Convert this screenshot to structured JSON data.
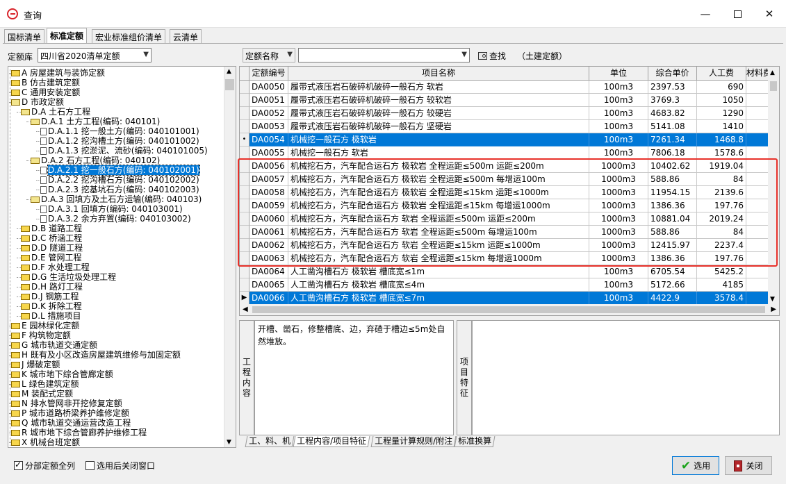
{
  "window": {
    "title": "查询"
  },
  "tabs": [
    {
      "label": "国标清单",
      "active": false
    },
    {
      "label": "标准定额",
      "active": true
    },
    {
      "label": "宏业标准组价清单",
      "active": false
    },
    {
      "label": "云清单",
      "active": false
    }
  ],
  "toolbar": {
    "lib_label": "定额库",
    "lib_value": "四川省2020清单定额",
    "field_value": "定额名称",
    "search_value": "",
    "find_label": "查找",
    "category_note": "（土建定额）"
  },
  "tree": [
    {
      "label": "A 房屋建筑与装饰定额",
      "level": 0,
      "icon": "folder"
    },
    {
      "label": "B 仿古建筑定额",
      "level": 0,
      "icon": "folder"
    },
    {
      "label": "C 通用安装定额",
      "level": 0,
      "icon": "folder"
    },
    {
      "label": "D 市政定额",
      "level": 0,
      "icon": "folder-open"
    },
    {
      "label": "D.A 土石方工程",
      "level": 1,
      "icon": "folder-open"
    },
    {
      "label": "D.A.1 土方工程(编码: 040101)",
      "level": 2,
      "icon": "folder-open"
    },
    {
      "label": "D.A.1.1 挖一般土方(编码: 040101001)",
      "level": 3,
      "icon": "doc"
    },
    {
      "label": "D.A.1.2 挖沟槽土方(编码: 040101002)",
      "level": 3,
      "icon": "doc"
    },
    {
      "label": "D.A.1.3 挖淤泥、流砂(编码: 040101005)",
      "level": 3,
      "icon": "doc"
    },
    {
      "label": "D.A.2 石方工程(编码: 040102)",
      "level": 2,
      "icon": "folder-open"
    },
    {
      "label": "D.A.2.1 挖一般石方(编码: 040102001)",
      "level": 3,
      "icon": "doc",
      "selected": true
    },
    {
      "label": "D.A.2.2 挖沟槽石方(编码: 040102002)",
      "level": 3,
      "icon": "doc"
    },
    {
      "label": "D.A.2.3 挖基坑石方(编码: 040102003)",
      "level": 3,
      "icon": "doc"
    },
    {
      "label": "D.A.3 回填方及土石方运输(编码: 040103)",
      "level": 2,
      "icon": "folder-open"
    },
    {
      "label": "D.A.3.1 回填方(编码: 040103001)",
      "level": 3,
      "icon": "doc"
    },
    {
      "label": "D.A.3.2 余方弃置(编码: 040103002)",
      "level": 3,
      "icon": "doc"
    },
    {
      "label": "D.B 道路工程",
      "level": 1,
      "icon": "folder"
    },
    {
      "label": "D.C 桥涵工程",
      "level": 1,
      "icon": "folder"
    },
    {
      "label": "D.D 隧道工程",
      "level": 1,
      "icon": "folder"
    },
    {
      "label": "D.E 管网工程",
      "level": 1,
      "icon": "folder"
    },
    {
      "label": "D.F 水处理工程",
      "level": 1,
      "icon": "folder"
    },
    {
      "label": "D.G 生活垃圾处理工程",
      "level": 1,
      "icon": "folder"
    },
    {
      "label": "D.H 路灯工程",
      "level": 1,
      "icon": "folder"
    },
    {
      "label": "D.J 钢筋工程",
      "level": 1,
      "icon": "folder"
    },
    {
      "label": "D.K 拆除工程",
      "level": 1,
      "icon": "folder"
    },
    {
      "label": "D.L 措施项目",
      "level": 1,
      "icon": "folder"
    },
    {
      "label": "E 园林绿化定额",
      "level": 0,
      "icon": "folder"
    },
    {
      "label": "F 构筑物定额",
      "level": 0,
      "icon": "folder"
    },
    {
      "label": "G 城市轨道交通定额",
      "level": 0,
      "icon": "folder"
    },
    {
      "label": "H 既有及小区改造房屋建筑维修与加固定额",
      "level": 0,
      "icon": "folder"
    },
    {
      "label": "J 爆破定额",
      "level": 0,
      "icon": "folder"
    },
    {
      "label": "K 城市地下综合管廊定额",
      "level": 0,
      "icon": "folder"
    },
    {
      "label": "L 绿色建筑定额",
      "level": 0,
      "icon": "folder"
    },
    {
      "label": "M 装配式定额",
      "level": 0,
      "icon": "folder"
    },
    {
      "label": "N 排水管网非开挖修复定额",
      "level": 0,
      "icon": "folder"
    },
    {
      "label": "P 城市道路桥梁养护维修定额",
      "level": 0,
      "icon": "folder"
    },
    {
      "label": "Q 城市轨道交通运营改造工程",
      "level": 0,
      "icon": "folder"
    },
    {
      "label": "R 城市地下综合管廊养护维修工程",
      "level": 0,
      "icon": "folder"
    },
    {
      "label": "X 机械台班定额",
      "level": 0,
      "icon": "folder"
    }
  ],
  "grid": {
    "columns": [
      "定额编号",
      "项目名称",
      "单位",
      "综合单价",
      "人工费",
      "材料费"
    ],
    "rows": [
      {
        "code": "DA0050",
        "name": "履带式液压岩石破碎机破碎一般石方 软岩",
        "unit": "100m3",
        "price": "2397.53",
        "labor": "690"
      },
      {
        "code": "DA0051",
        "name": "履带式液压岩石破碎机破碎一般石方 较软岩",
        "unit": "100m3",
        "price": "3769.3",
        "labor": "1050"
      },
      {
        "code": "DA0052",
        "name": "履带式液压岩石破碎机破碎一般石方 较硬岩",
        "unit": "100m3",
        "price": "4683.82",
        "labor": "1290"
      },
      {
        "code": "DA0053",
        "name": "履带式液压岩石破碎机破碎一般石方 坚硬岩",
        "unit": "100m3",
        "price": "5141.08",
        "labor": "1410"
      },
      {
        "code": "DA0054",
        "name": "机械挖一般石方 极软岩",
        "unit": "100m3",
        "price": "7261.34",
        "labor": "1468.8",
        "selected": true,
        "marker": "•"
      },
      {
        "code": "DA0055",
        "name": "机械挖一般石方 软岩",
        "unit": "100m3",
        "price": "7806.18",
        "labor": "1578.6"
      },
      {
        "code": "DA0056",
        "name": "机械挖石方，汽车配合运石方 极软岩 全程运距≤500m 运距≤200m",
        "unit": "1000m3",
        "price": "10402.62",
        "labor": "1919.04"
      },
      {
        "code": "DA0057",
        "name": "机械挖石方，汽车配合运石方 极软岩 全程运距≤500m 每增运100m",
        "unit": "1000m3",
        "price": "588.86",
        "labor": "84"
      },
      {
        "code": "DA0058",
        "name": "机械挖石方，汽车配合运石方 极软岩 全程运距≤15km 运距≤1000m",
        "unit": "1000m3",
        "price": "11954.15",
        "labor": "2139.6"
      },
      {
        "code": "DA0059",
        "name": "机械挖石方，汽车配合运石方 极软岩 全程运距≤15km 每增运1000m",
        "unit": "1000m3",
        "price": "1386.36",
        "labor": "197.76"
      },
      {
        "code": "DA0060",
        "name": "机械挖石方，汽车配合运石方 软岩 全程运距≤500m 运距≤200m",
        "unit": "1000m3",
        "price": "10881.04",
        "labor": "2019.24"
      },
      {
        "code": "DA0061",
        "name": "机械挖石方，汽车配合运石方 软岩 全程运距≤500m 每增运100m",
        "unit": "1000m3",
        "price": "588.86",
        "labor": "84"
      },
      {
        "code": "DA0062",
        "name": "机械挖石方，汽车配合运石方 软岩 全程运距≤15km 运距≤1000m",
        "unit": "1000m3",
        "price": "12415.97",
        "labor": "2237.4"
      },
      {
        "code": "DA0063",
        "name": "机械挖石方，汽车配合运石方 软岩 全程运距≤15km 每增运1000m",
        "unit": "1000m3",
        "price": "1386.36",
        "labor": "197.76"
      },
      {
        "code": "DA0064",
        "name": "人工凿沟槽石方 极软岩 槽底宽≤1m",
        "unit": "100m3",
        "price": "6705.54",
        "labor": "5425.2"
      },
      {
        "code": "DA0065",
        "name": "人工凿沟槽石方 极软岩 槽底宽≤4m",
        "unit": "100m3",
        "price": "5172.66",
        "labor": "4185"
      },
      {
        "code": "DA0066",
        "name": "人工凿沟槽石方 极软岩 槽底宽≤7m",
        "unit": "100m3",
        "price": "4422.9",
        "labor": "3578.4",
        "selected": true,
        "marker": "▶"
      }
    ]
  },
  "detail": {
    "work_label": "工程内容",
    "work_content": "开槽、凿石，修整槽底、边，弃碴于槽边≤5m处自然堆放。",
    "feature_label": "项目特征"
  },
  "bottom_tabs": [
    {
      "label": "工、料、机",
      "active": false
    },
    {
      "label": "工程内容/项目特征",
      "active": true
    },
    {
      "label": "工程量计算规则/附注",
      "active": false
    },
    {
      "label": "标准换算",
      "active": false
    }
  ],
  "footer": {
    "chk_all_label": "分部定额全列",
    "chk_all": true,
    "chk_close_label": "选用后关闭窗口",
    "chk_close": false,
    "select_label": "选用",
    "close_label": "关闭"
  },
  "colors": {
    "selection": "#0078d7",
    "highlight_box": "#e8312a",
    "confirm_green": "#1aa31a",
    "close_red": "#b3262b"
  },
  "icons": [
    "app-logo-icon",
    "minimize-icon",
    "maximize-icon",
    "close-icon",
    "folder-icon",
    "document-icon",
    "find-icon",
    "check-icon",
    "exit-icon"
  ]
}
